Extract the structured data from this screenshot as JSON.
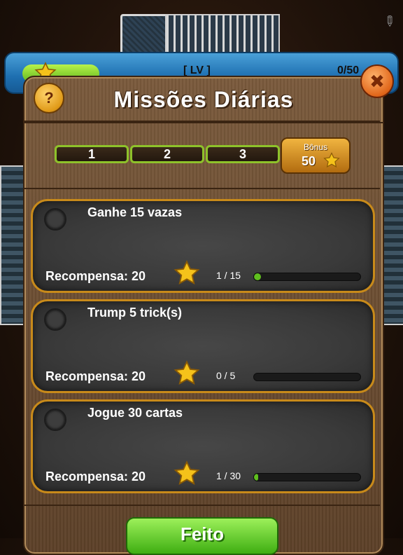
{
  "level_bar": {
    "label": "[ LV ]",
    "count": "0/50"
  },
  "dialog": {
    "title": "Missões Diárias",
    "help_label": "?",
    "close_label": "✖",
    "segments": [
      "1",
      "2",
      "3"
    ],
    "bonus": {
      "label": "Bônus",
      "value": "50"
    }
  },
  "missions": [
    {
      "title": "Ganhe 15 vazas",
      "reward_label": "Recompensa: 20",
      "progress_text": "1 / 15",
      "progress": 0.067
    },
    {
      "title": "Trump 5 trick(s)",
      "reward_label": "Recompensa: 20",
      "progress_text": "0 / 5",
      "progress": 0.0
    },
    {
      "title": "Jogue 30 cartas",
      "reward_label": "Recompensa: 20",
      "progress_text": "1 / 30",
      "progress": 0.033
    }
  ],
  "done_button": "Feito",
  "colors": {
    "panel_wood": "#5c4028",
    "card_border": "#c88a1a",
    "progress_green": "#5fbe1e",
    "star": "#f5c21a"
  },
  "icons": {
    "star": "star-icon",
    "help": "question-icon",
    "close": "close-icon",
    "checkbox": "circle-checkbox-icon",
    "pencil": "pencil-icon"
  }
}
